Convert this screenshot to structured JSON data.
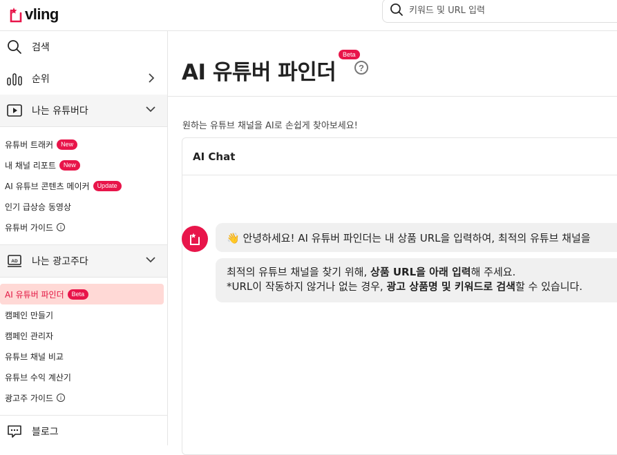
{
  "header": {
    "logo_text": "vling",
    "search_placeholder": "키워드 및 URL 입력"
  },
  "sidebar": {
    "search_label": "검색",
    "ranking_label": "순위",
    "section_youtuber": "나는 유튜버다",
    "youtuber_items": [
      {
        "label": "유튜버 트래커",
        "badge": "New"
      },
      {
        "label": "내 채널 리포트",
        "badge": "New"
      },
      {
        "label": "AI 유튜브 콘텐츠 메이커",
        "badge": "Update"
      },
      {
        "label": "인기 급상승 동영상"
      },
      {
        "label": "유튜버 가이드",
        "info": "i"
      }
    ],
    "section_advertiser": "나는 광고주다",
    "advertiser_items": [
      {
        "label": "AI 유튜버 파인더",
        "badge": "Beta",
        "active": true
      },
      {
        "label": "캠페인 만들기"
      },
      {
        "label": "캠페인 관리자"
      },
      {
        "label": "유튜브 채널 비교"
      },
      {
        "label": "유튜브 수익 계산기"
      },
      {
        "label": "광고주 가이드",
        "info": "i"
      }
    ],
    "blog_label": "블로그"
  },
  "main": {
    "title": "AI 유튜버 파인더",
    "title_badge": "Beta",
    "help_glyph": "?",
    "subtitle": "원하는 유튜브 채널을 AI로 손쉽게 찾아보세요!",
    "chat_title": "AI Chat",
    "message1": "👋 안녕하세요! AI 유튜버 파인더는 내 상품 URL을 입력하여, 최적의 유튜브 채널을",
    "message2_line1_a": "최적의 유튜브 채널을 찾기 위해, ",
    "message2_line1_b": "상품 URL을 아래 입력",
    "message2_line1_c": "해 주세요.",
    "message2_line2_a": "*URL이 작동하지 않거나 없는 경우, ",
    "message2_line2_b": "광고 상품명 및 키워드로 검색",
    "message2_line2_c": "할 수 있습니다."
  },
  "colors": {
    "accent": "#e8154a",
    "active_bg": "#ffd9d6",
    "section_bg": "#f5f5f5",
    "bubble_bg": "#f0f0f0"
  }
}
